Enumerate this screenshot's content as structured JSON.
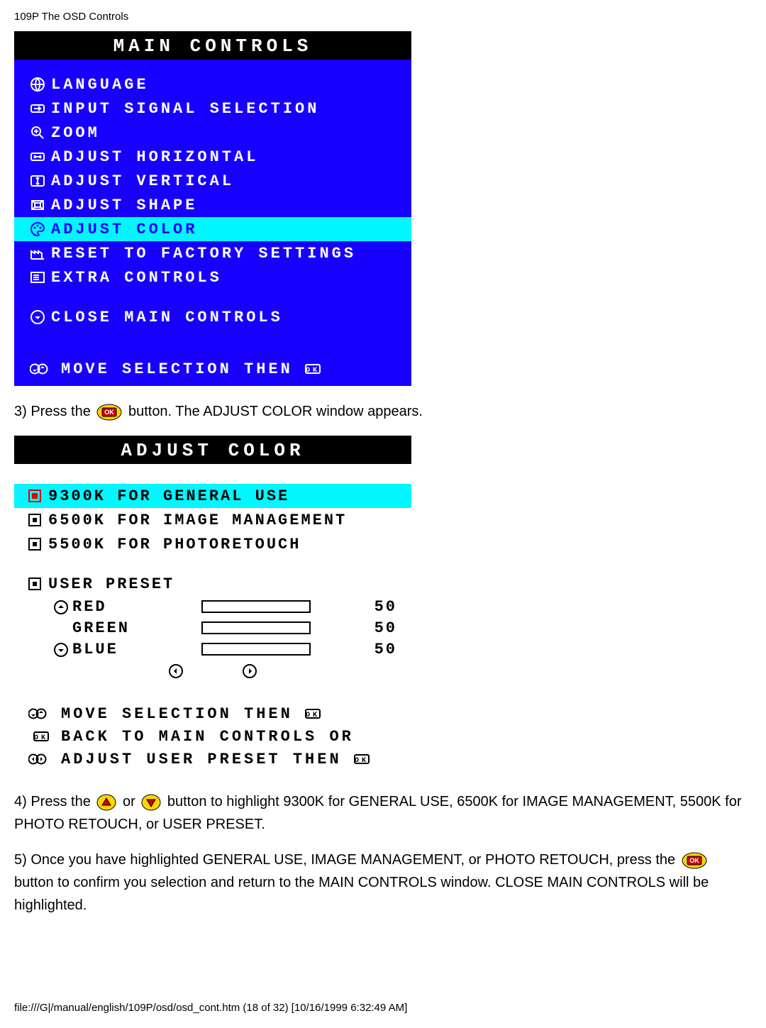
{
  "doc": {
    "header": "109P The OSD Controls",
    "footer": "file:///G|/manual/english/109P/osd/osd_cont.htm (18 of 32) [10/16/1999 6:32:49 AM]"
  },
  "main_controls": {
    "title": "MAIN CONTROLS",
    "items": [
      {
        "icon": "globe-icon",
        "label": "LANGUAGE"
      },
      {
        "icon": "input-icon",
        "label": "INPUT SIGNAL SELECTION"
      },
      {
        "icon": "zoom-icon",
        "label": "ZOOM"
      },
      {
        "icon": "horiz-icon",
        "label": "ADJUST HORIZONTAL"
      },
      {
        "icon": "vert-icon",
        "label": "ADJUST VERTICAL"
      },
      {
        "icon": "shape-icon",
        "label": "ADJUST SHAPE"
      },
      {
        "icon": "palette-icon",
        "label": "ADJUST COLOR",
        "selected": true
      },
      {
        "icon": "factory-icon",
        "label": "RESET TO FACTORY SETTINGS"
      },
      {
        "icon": "extra-icon",
        "label": "EXTRA CONTROLS"
      }
    ],
    "close_label": "CLOSE MAIN CONTROLS",
    "hint": "MOVE SELECTION THEN"
  },
  "step3": {
    "prefix": "3) Press the ",
    "suffix": " button. The ADJUST COLOR window appears."
  },
  "adjust_color": {
    "title": "ADJUST COLOR",
    "options": [
      {
        "label": "9300K FOR GENERAL USE",
        "selected": true,
        "icon_red": true
      },
      {
        "label": "6500K FOR IMAGE MANAGEMENT"
      },
      {
        "label": "5500K FOR PHOTORETOUCH"
      }
    ],
    "user_preset_label": "USER PRESET",
    "channels": [
      {
        "name": "RED",
        "value": 50,
        "upicon": "up"
      },
      {
        "name": "GREEN",
        "value": 50,
        "upicon": ""
      },
      {
        "name": "BLUE",
        "value": 50,
        "upicon": "down"
      }
    ],
    "hints": {
      "move": "MOVE SELECTION THEN",
      "back": "BACK TO MAIN CONTROLS OR",
      "adjust": "ADJUST USER PRESET THEN"
    }
  },
  "step4": {
    "prefix": "4) Press the ",
    "mid": " or ",
    "suffix": " button to highlight 9300K for GENERAL USE, 6500K for IMAGE MANAGEMENT, 5500K for PHOTO RETOUCH, or USER PRESET."
  },
  "step5": {
    "prefix": "5) Once you have highlighted GENERAL USE, IMAGE MANAGEMENT, or PHOTO RETOUCH, press the ",
    "suffix": " button to confirm you selection and return to the MAIN CONTROLS window. CLOSE MAIN CONTROLS will be highlighted."
  }
}
